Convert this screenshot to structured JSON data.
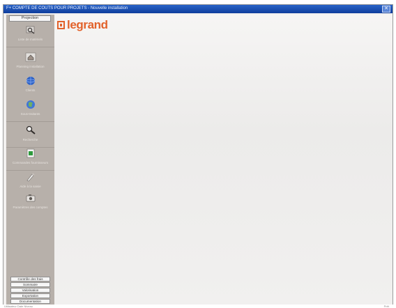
{
  "window": {
    "title": "F+ COMPTE DE COUTS POUR PROJETS - Nouvelle installation",
    "close_glyph": "✕"
  },
  "logo": {
    "text": "legrand",
    "brand_color": "#e2622b"
  },
  "sidebar": {
    "header_tab": "Projection",
    "items": [
      {
        "label": "Liste de matériels",
        "icon": "magnifier-icon"
      },
      {
        "label": "Planning installation",
        "icon": "house-icon"
      },
      {
        "label": "Clients",
        "icon": "globe-blue-icon"
      },
      {
        "label": "Sous-traitants",
        "icon": "globe-icon"
      },
      {
        "label": "Recherche",
        "icon": "search-icon"
      },
      {
        "label": "Commandes fournisseurs",
        "icon": "document-green-icon"
      },
      {
        "label": "Aide à la saisie",
        "icon": "pen-icon"
      },
      {
        "label": "Paramètres des comptes",
        "icon": "camera-icon"
      }
    ],
    "buttons": [
      "Contrôle des frais",
      "Sommaire",
      "Valorisation",
      "Exportation",
      "Documentation"
    ]
  },
  "statusbar": {
    "left": "Utilisateur   Date   Niveau",
    "right": "Prêt"
  }
}
